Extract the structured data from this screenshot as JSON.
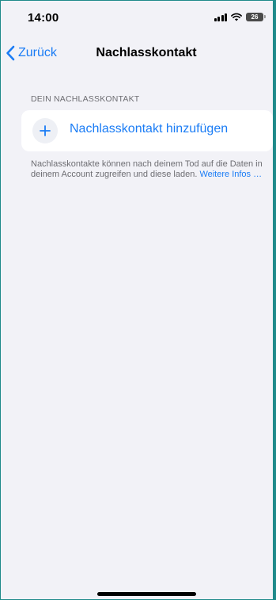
{
  "status_bar": {
    "time": "14:00",
    "battery_level": "26",
    "icons": [
      "signal-icon",
      "wifi-icon",
      "battery-icon"
    ]
  },
  "nav": {
    "back_label": "Zurück",
    "title": "Nachlasskontakt"
  },
  "section": {
    "header": "DEIN NACHLASSKONTAKT",
    "add_label": "Nachlasskontakt hinzufügen",
    "footnote_text": "Nachlasskontakte können nach deinem Tod auf die Daten in deinem Account zugreifen und diese laden.",
    "footnote_link": "Weitere Infos …"
  },
  "colors": {
    "accent": "#1a7cf5",
    "background": "#f2f2f7",
    "secondary_text": "#6d6d72"
  }
}
